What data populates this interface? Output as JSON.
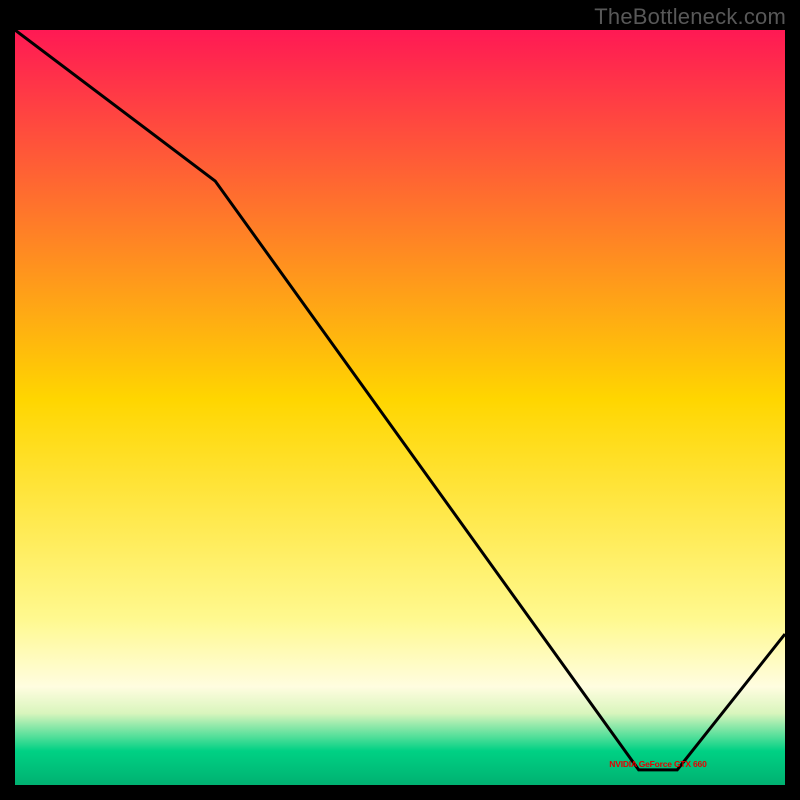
{
  "attribution": "TheBottleneck.com",
  "marker_label": "NVIDIA GeForce GTX 660",
  "chart_data": {
    "type": "line",
    "title": "",
    "xlabel": "",
    "ylabel": "",
    "ylim": [
      0,
      100
    ],
    "xlim": [
      0,
      100
    ],
    "x": [
      0,
      26,
      81,
      86,
      100
    ],
    "y": [
      100,
      80,
      2,
      2,
      20
    ],
    "series_color": "#000000",
    "background_gradient": [
      {
        "stop": 0.0,
        "color": "#ff1954"
      },
      {
        "stop": 0.49,
        "color": "#ffd600"
      },
      {
        "stop": 0.78,
        "color": "#fff98f"
      },
      {
        "stop": 0.87,
        "color": "#fffde0"
      },
      {
        "stop": 0.905,
        "color": "#d9f5bd"
      },
      {
        "stop": 0.955,
        "color": "#00d184"
      },
      {
        "stop": 1.0,
        "color": "#00b171"
      }
    ],
    "marker": {
      "x_center": 83.5,
      "y": 2
    }
  }
}
